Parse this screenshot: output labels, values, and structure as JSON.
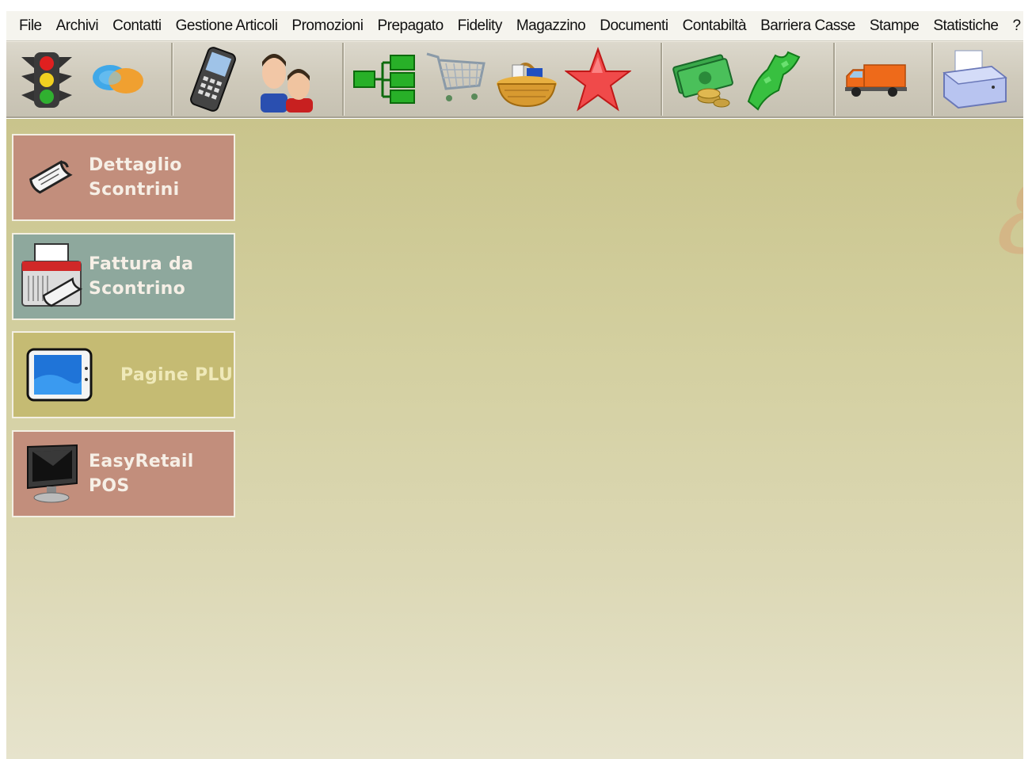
{
  "menu": {
    "items": [
      "File",
      "Archivi",
      "Contatti",
      "Gestione Articoli",
      "Promozioni",
      "Prepagato",
      "Fidelity",
      "Magazzino",
      "Documenti",
      "Contabiltà",
      "Barriera Casse",
      "Stampe",
      "Statistiche",
      "?"
    ]
  },
  "toolbar": {
    "groups": [
      [
        "traffic-light-icon",
        "chat-bubbles-icon"
      ],
      [
        "mobile-phone-icon",
        "people-icon"
      ],
      [
        "hierarchy-icon",
        "shopping-cart-icon",
        "basket-icon",
        "star-icon"
      ],
      [
        "money-coins-icon",
        "cash-flow-icon"
      ],
      [
        "delivery-truck-icon"
      ],
      [
        "printer-icon"
      ]
    ]
  },
  "tiles": [
    {
      "label": "Dettaglio\nScontrini",
      "icon": "receipt-icon",
      "color": "#c28e7c"
    },
    {
      "label": "Fattura da\nScontrino",
      "icon": "invoice-printer-icon",
      "color": "#8ea89d"
    },
    {
      "label": "Pagine PLU",
      "icon": "tablet-icon",
      "color": "#c5bb73"
    },
    {
      "label": "EasyRetail\nPOS",
      "icon": "monitor-icon",
      "color": "#c28e7c"
    }
  ],
  "colors": {
    "workspace_top": "#c9c48c",
    "workspace_bottom": "#e6e3cc",
    "menubar": "#f5f4ee"
  }
}
